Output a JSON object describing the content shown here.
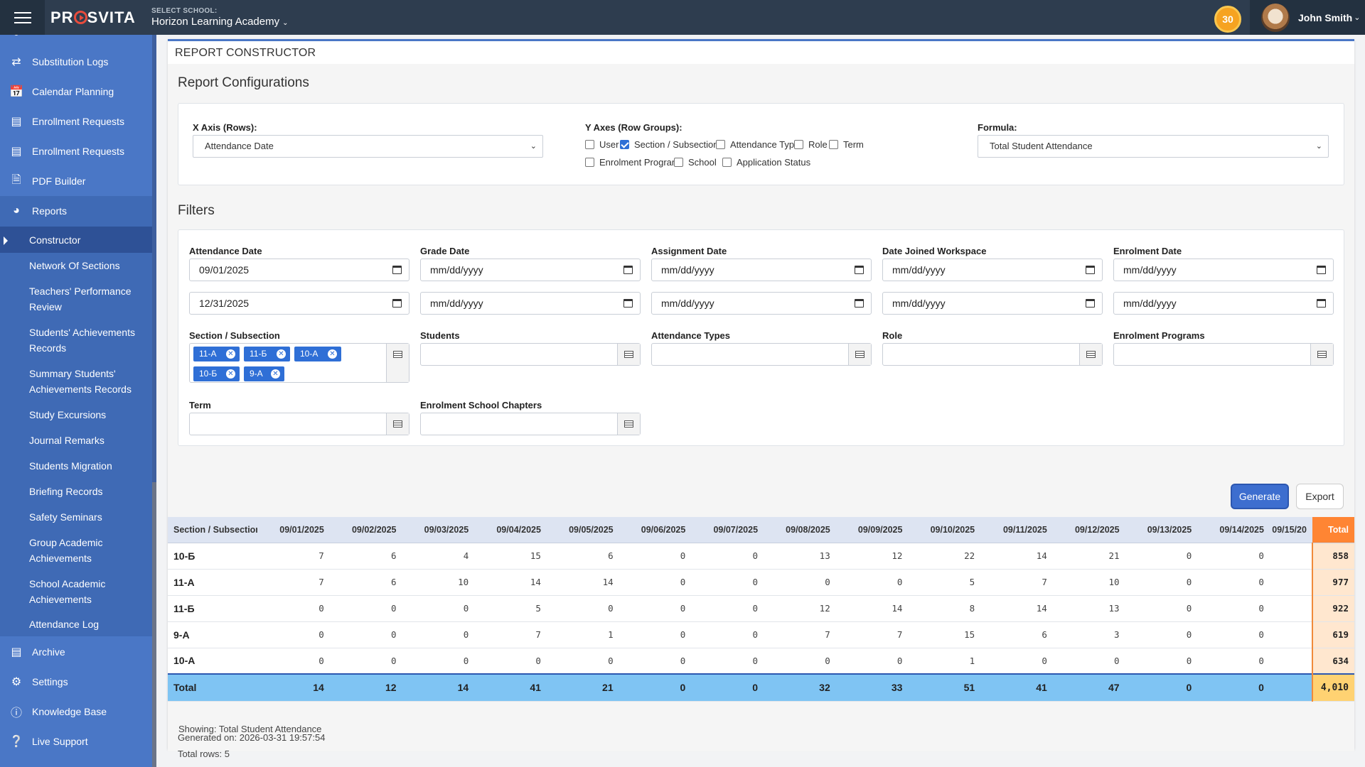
{
  "topbar": {
    "brand": "PROSVITA",
    "brand_pre": "PR",
    "brand_post": "SVITA",
    "school_label": "SELECT SCHOOL:",
    "school_value": "Horizon Learning Academy",
    "coins": "30",
    "user_name": "John Smith"
  },
  "sidebar": {
    "items": [
      {
        "label": "Substitution Logs",
        "icon": "swap-icon"
      },
      {
        "label": "Calendar Planning",
        "icon": "calendar-check-icon"
      },
      {
        "label": "Enrollment Requests",
        "icon": "id-card-icon"
      },
      {
        "label": "Enrollment Requests",
        "icon": "id-card-icon"
      },
      {
        "label": "PDF Builder",
        "icon": "pdf-file-icon"
      },
      {
        "label": "Reports",
        "icon": "pie-chart-icon"
      }
    ],
    "report_subitems": [
      "Constructor",
      "Network Of Sections",
      "Teachers' Performance Review",
      "Students' Achievements Records",
      "Summary Students' Achievements Records",
      "Study Excursions",
      "Journal Remarks",
      "Students Migration",
      "Briefing Records",
      "Safety Seminars",
      "Group Academic Achievements",
      "School Academic Achievements",
      "Attendance Log"
    ],
    "bottom_items": [
      {
        "label": "Archive",
        "icon": "archive-icon"
      },
      {
        "label": "Settings",
        "icon": "gears-icon"
      },
      {
        "label": "Knowledge Base",
        "icon": "info-icon"
      },
      {
        "label": "Live Support",
        "icon": "question-icon"
      }
    ]
  },
  "panel": {
    "title": "REPORT CONSTRUCTOR",
    "config_title": "Report Configurations",
    "x_axis_label": "X Axis (Rows):",
    "x_axis_value": "Attendance Date",
    "y_axes_label": "Y Axes (Row Groups):",
    "y_axes_options": [
      {
        "label": "User",
        "checked": false
      },
      {
        "label": "Section / Subsection",
        "checked": true
      },
      {
        "label": "Attendance Type",
        "checked": false
      },
      {
        "label": "Role",
        "checked": false
      },
      {
        "label": "Term",
        "checked": false
      },
      {
        "label": "Enrolment Program",
        "checked": false
      },
      {
        "label": "School",
        "checked": false
      },
      {
        "label": "Application Status",
        "checked": false
      }
    ],
    "formula_label": "Formula:",
    "formula_value": "Total Student Attendance",
    "filters_title": "Filters",
    "date_filters": [
      {
        "label": "Attendance Date",
        "from": "09/01/2025",
        "to": "12/31/2025"
      },
      {
        "label": "Grade Date",
        "from": "mm/dd/yyyy",
        "to": "mm/dd/yyyy"
      },
      {
        "label": "Assignment Date",
        "from": "mm/dd/yyyy",
        "to": "mm/dd/yyyy"
      },
      {
        "label": "Date Joined Workspace",
        "from": "mm/dd/yyyy",
        "to": "mm/dd/yyyy"
      },
      {
        "label": "Enrolment Date",
        "from": "mm/dd/yyyy",
        "to": "mm/dd/yyyy"
      }
    ],
    "multi_filters": [
      "Section / Subsection",
      "Students",
      "Attendance Types",
      "Role",
      "Enrolment Programs",
      "Term",
      "Enrolment School Chapters"
    ],
    "section_tags": [
      "11-A",
      "11-Б",
      "10-A",
      "10-Б",
      "9-A"
    ],
    "generate_label": "Generate",
    "export_label": "Export"
  },
  "table": {
    "headers": [
      "Section / Subsection",
      "09/01/2025",
      "09/02/2025",
      "09/03/2025",
      "09/04/2025",
      "09/05/2025",
      "09/06/2025",
      "09/07/2025",
      "09/08/2025",
      "09/09/2025",
      "09/10/2025",
      "09/11/2025",
      "09/12/2025",
      "09/13/2025",
      "09/14/2025",
      "09/15/20",
      "Total"
    ],
    "rows": [
      {
        "name": "10-Б",
        "values": [
          "7",
          "6",
          "4",
          "15",
          "6",
          "0",
          "0",
          "13",
          "12",
          "22",
          "14",
          "21",
          "0",
          "0",
          ""
        ],
        "total": "858"
      },
      {
        "name": "11-A",
        "values": [
          "7",
          "6",
          "10",
          "14",
          "14",
          "0",
          "0",
          "0",
          "0",
          "5",
          "7",
          "10",
          "0",
          "0",
          ""
        ],
        "total": "977"
      },
      {
        "name": "11-Б",
        "values": [
          "0",
          "0",
          "0",
          "5",
          "0",
          "0",
          "0",
          "12",
          "14",
          "8",
          "14",
          "13",
          "0",
          "0",
          ""
        ],
        "total": "922"
      },
      {
        "name": "9-A",
        "values": [
          "0",
          "0",
          "0",
          "7",
          "1",
          "0",
          "0",
          "7",
          "7",
          "15",
          "6",
          "3",
          "0",
          "0",
          ""
        ],
        "total": "619"
      },
      {
        "name": "10-A",
        "values": [
          "0",
          "0",
          "0",
          "0",
          "0",
          "0",
          "0",
          "0",
          "0",
          "1",
          "0",
          "0",
          "0",
          "0",
          ""
        ],
        "total": "634"
      }
    ],
    "total_row": {
      "name": "Total",
      "values": [
        "14",
        "12",
        "14",
        "41",
        "21",
        "0",
        "0",
        "32",
        "33",
        "51",
        "41",
        "47",
        "0",
        "0",
        ""
      ],
      "total": "4,010"
    }
  },
  "footer": {
    "generated": "Generated on: 2026-03-31 19:57:54",
    "rows": "Total rows: 5",
    "showing": "Showing: Total Student Attendance"
  },
  "colors": {
    "topbar": "#2e3d4f",
    "sidebar": "#4a77c6",
    "accent": "#3d6ecf",
    "total_header": "#ff8533"
  }
}
